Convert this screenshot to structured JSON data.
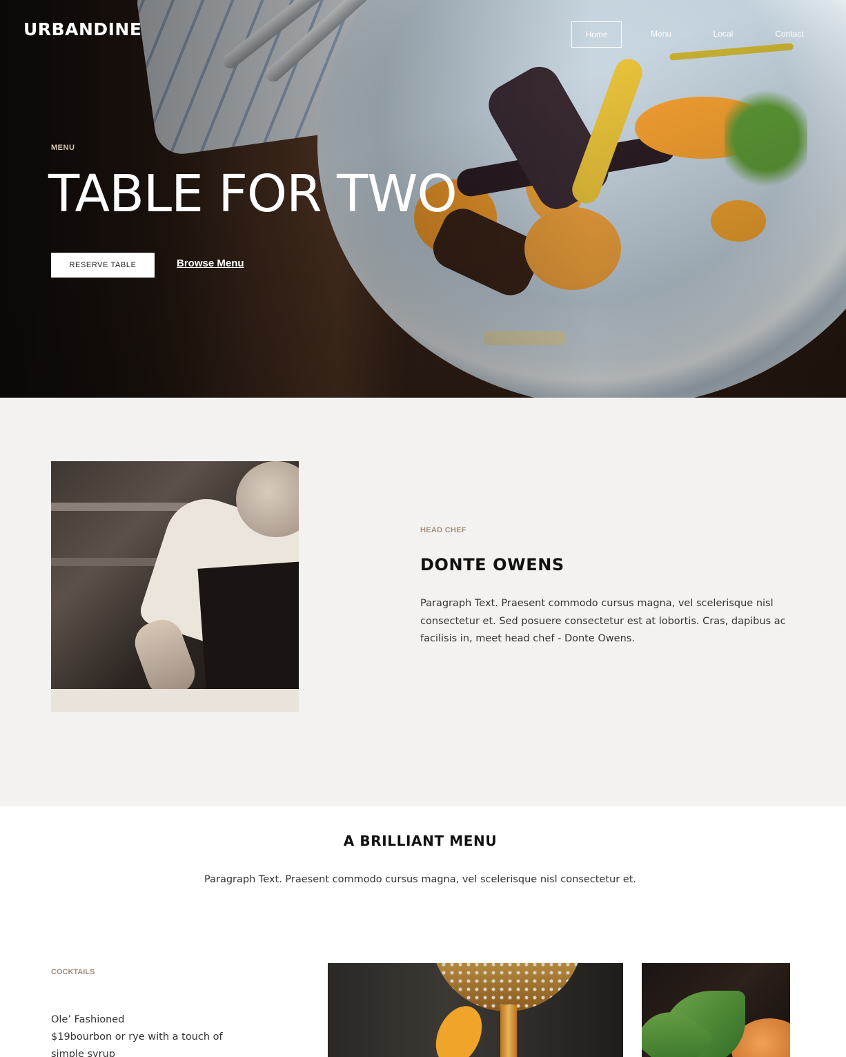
{
  "brand": {
    "logo": "URBANDINE"
  },
  "nav": {
    "items": [
      {
        "label": "Home",
        "active": true
      },
      {
        "label": "Menu",
        "active": false
      },
      {
        "label": "Local",
        "active": false
      },
      {
        "label": "Contact",
        "active": false
      }
    ]
  },
  "hero": {
    "kicker": "MENU",
    "title": "TABLE FOR TWO",
    "reserve_button": "RESERVE TABLE",
    "browse_link": "Browse Menu"
  },
  "chef": {
    "kicker": "HEAD CHEF",
    "name": "DONTE OWENS",
    "text": "Paragraph Text. Praesent commodo cursus magna, vel scelerisque nisl consectetur et. Sed posuere consectetur est at lobortis. Cras, dapibus ac facilisis in, meet head chef - Donte Owens."
  },
  "menu": {
    "title": "A BRILLIANT MENU",
    "text": "Paragraph Text. Praesent commodo cursus magna, vel scelerisque nisl consectetur et.",
    "cocktails": {
      "kicker": "COCKTAILS",
      "items": [
        {
          "name": "Ole’ Fashioned",
          "price_desc": "$19bourbon or rye with a touch of simple syrup"
        }
      ]
    }
  },
  "colors": {
    "kicker_accent": "#a08f7b",
    "section_bg": "#f4f2f1",
    "hero_text": "#ffffff"
  }
}
